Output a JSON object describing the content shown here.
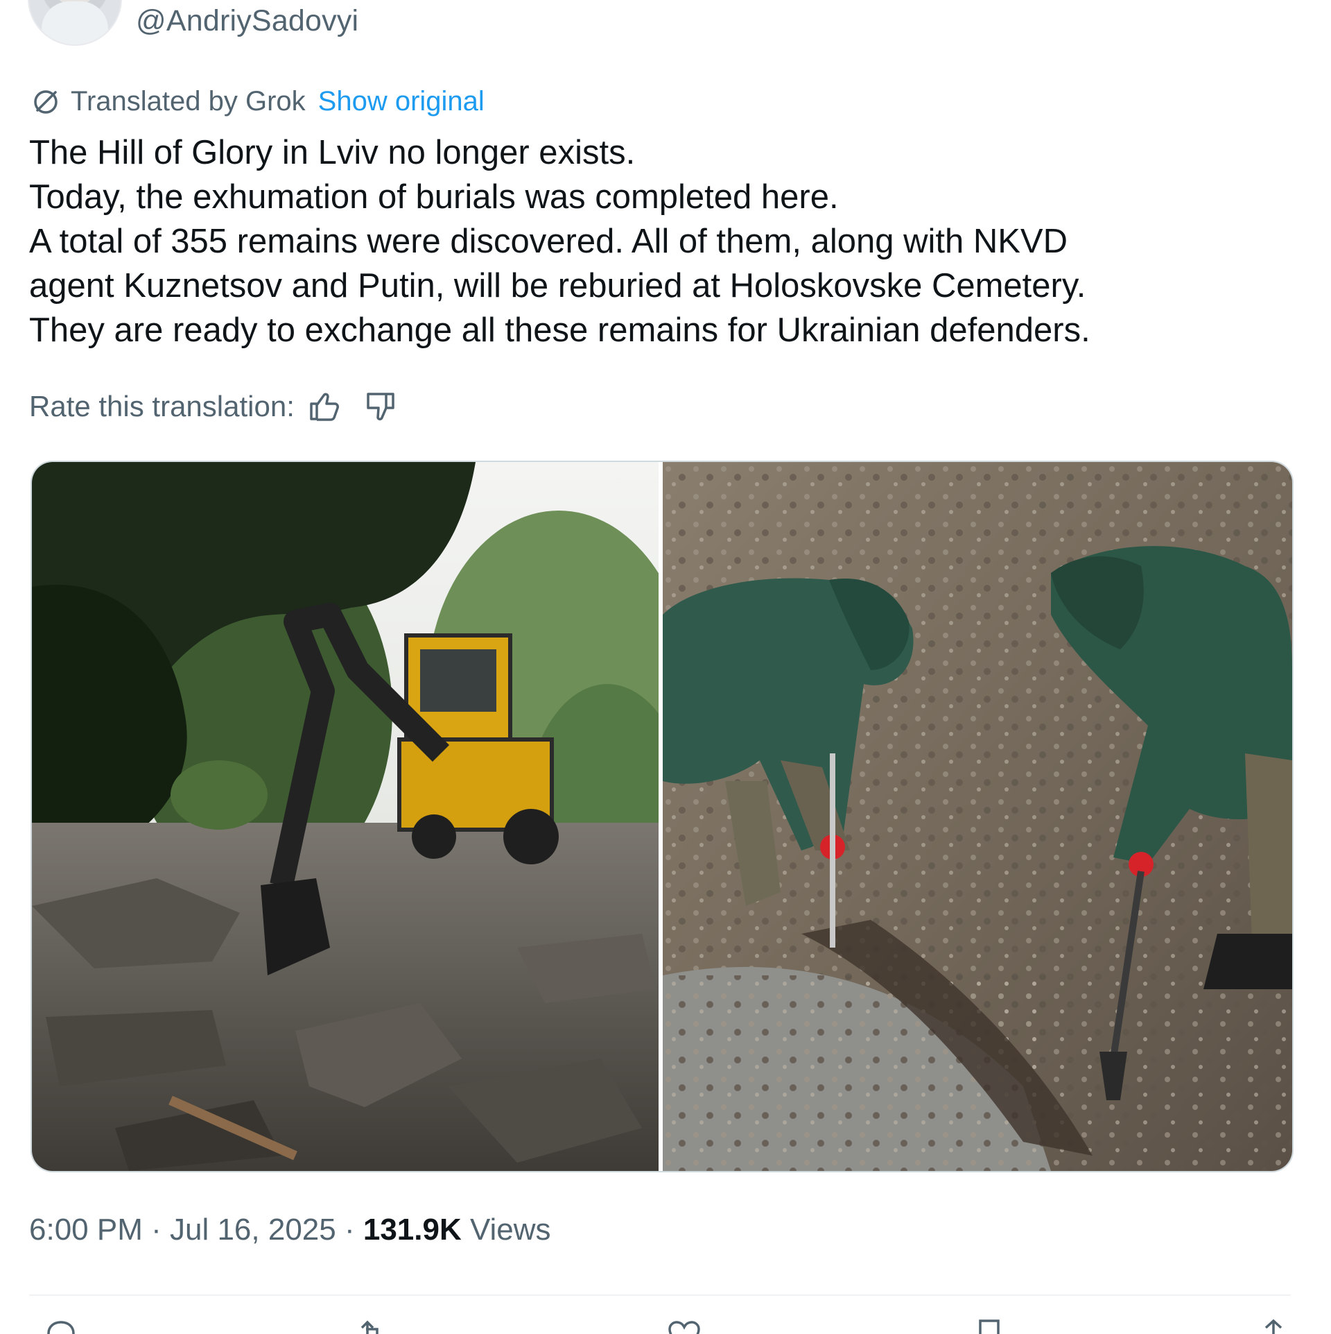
{
  "author": {
    "handle": "@AndriySadovyi"
  },
  "translation": {
    "label": "Translated by Grok",
    "show_original": "Show original",
    "rate_label": "Rate this translation:"
  },
  "tweet": {
    "lines": [
      "The Hill of Glory in Lviv no longer exists.",
      "Today, the exhumation of burials was completed here.",
      "A total of 355 remains were discovered. All of them, along with NKVD",
      "agent Kuznetsov and Putin, will be reburied at Holoskovske Cemetery.",
      "They are ready to exchange all these remains for Ukrainian defenders."
    ]
  },
  "media": [
    {
      "icon": "photo-excavator-rubble"
    },
    {
      "icon": "photo-workers-digging"
    }
  ],
  "meta": {
    "time": "6:00 PM",
    "sep1": " · ",
    "date": "Jul 16, 2025",
    "sep2": " · ",
    "views_count": "131.9K",
    "views_label": " Views"
  },
  "colors": {
    "text": "#0f1419",
    "secondary": "#536471",
    "link": "#1d9bf0",
    "border": "#cfd9de"
  }
}
